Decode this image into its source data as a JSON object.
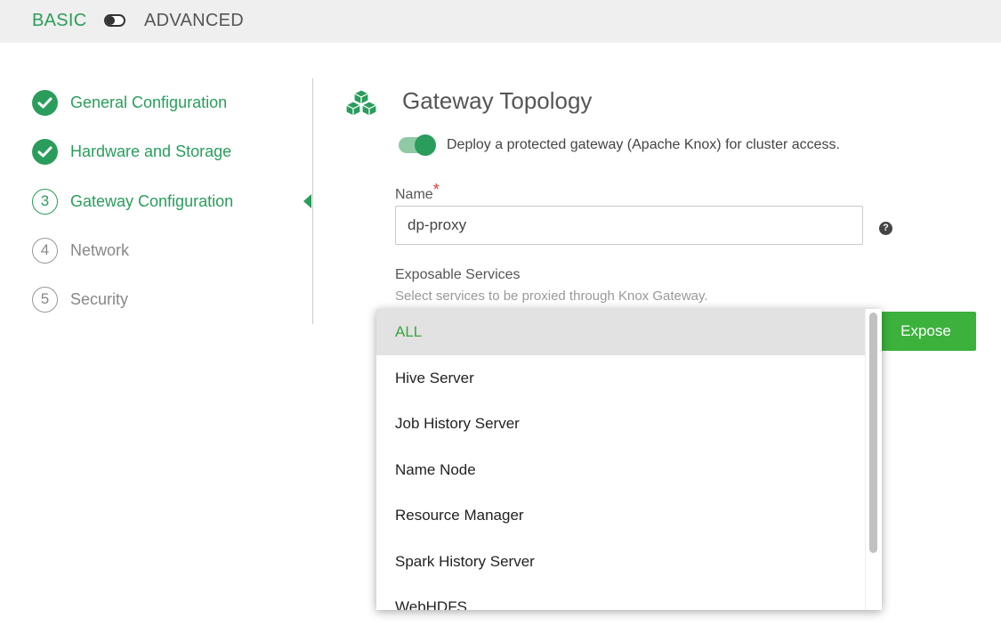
{
  "mode": {
    "basic": "BASIC",
    "advanced": "ADVANCED"
  },
  "steps": [
    {
      "label": "General Configuration",
      "state": "done"
    },
    {
      "label": "Hardware and Storage",
      "state": "done"
    },
    {
      "label": "Gateway Configuration",
      "number": "3",
      "state": "active"
    },
    {
      "label": "Network",
      "number": "4",
      "state": "pending"
    },
    {
      "label": "Security",
      "number": "5",
      "state": "pending"
    }
  ],
  "section": {
    "title": "Gateway Topology",
    "icon": "cubes-icon",
    "toggle_label": "Deploy a protected gateway (Apache Knox) for cluster access."
  },
  "name_field": {
    "label": "Name",
    "required_mark": "*",
    "value": "dp-proxy",
    "help": "?"
  },
  "exposable": {
    "label": "Exposable Services",
    "help_text": "Select services to be proxied through Knox Gateway.",
    "options": [
      "ALL",
      "Hive Server",
      "Job History Server",
      "Name Node",
      "Resource Manager",
      "Spark History Server",
      "WebHDFS"
    ],
    "selected": "ALL"
  },
  "expose_button": "Expose",
  "colors": {
    "accent": "#2a9d5c",
    "button": "#3cb13c",
    "required": "#e0403b"
  }
}
